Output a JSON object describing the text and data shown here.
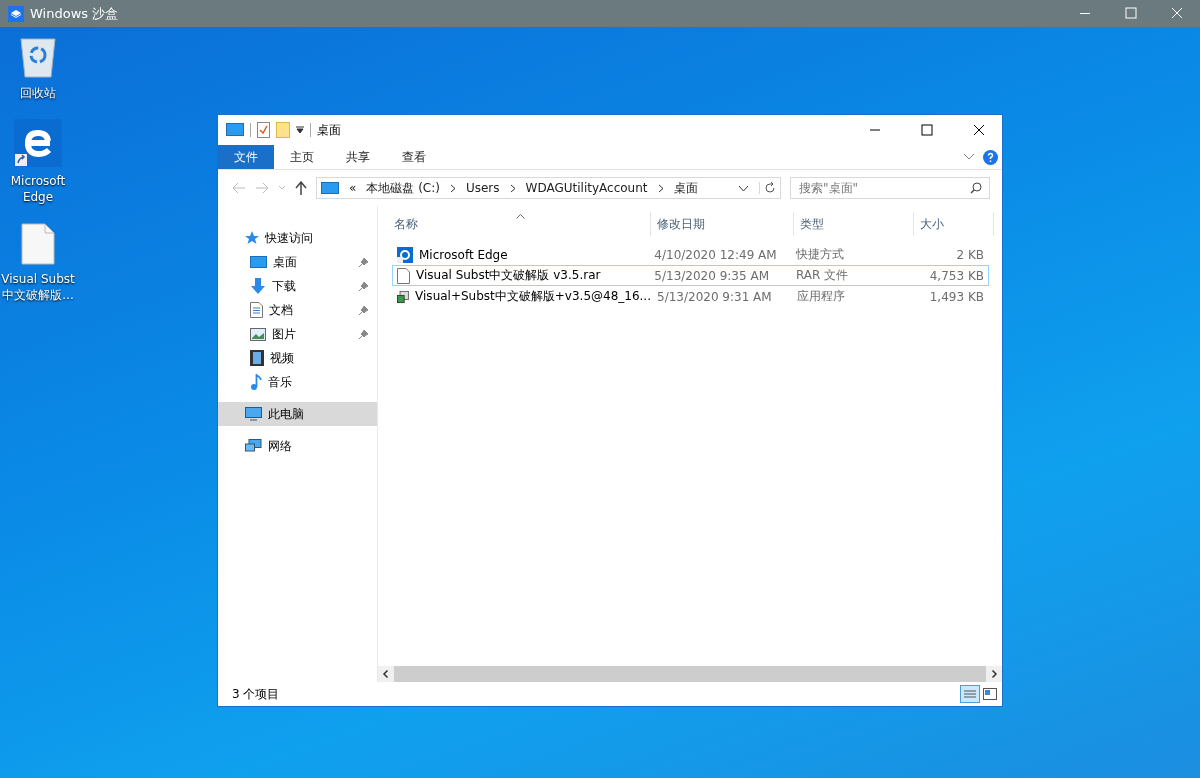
{
  "sandbox": {
    "title": "Windows 沙盒"
  },
  "desktop_icons": [
    {
      "label": "回收站",
      "kind": "recycle"
    },
    {
      "label": "Microsoft Edge",
      "kind": "edge"
    },
    {
      "label": "Visual Subst 中文破解版...",
      "kind": "file"
    }
  ],
  "explorer": {
    "title": "桌面",
    "ribbon_tabs": [
      {
        "label": "文件",
        "kind": "file"
      },
      {
        "label": "主页",
        "kind": "tab"
      },
      {
        "label": "共享",
        "kind": "tab"
      },
      {
        "label": "查看",
        "kind": "tab"
      }
    ],
    "address": {
      "prefix": "«",
      "segments": [
        "本地磁盘 (C:)",
        "Users",
        "WDAGUtilityAccount",
        "桌面"
      ]
    },
    "search": {
      "placeholder": "搜索\"桌面\""
    },
    "nav": [
      {
        "label": "快速访问",
        "kind": "star",
        "selected": false,
        "children": [
          {
            "label": "桌面",
            "kind": "desktop",
            "pinned": true,
            "selected": false
          },
          {
            "label": "下载",
            "kind": "download",
            "pinned": true,
            "selected": false
          },
          {
            "label": "文档",
            "kind": "document",
            "pinned": true,
            "selected": false
          },
          {
            "label": "图片",
            "kind": "picture",
            "pinned": true,
            "selected": false
          },
          {
            "label": "视频",
            "kind": "video",
            "pinned": false,
            "selected": false
          },
          {
            "label": "音乐",
            "kind": "music",
            "pinned": false,
            "selected": false
          }
        ]
      },
      {
        "label": "此电脑",
        "kind": "computer",
        "selected": true
      },
      {
        "label": "网络",
        "kind": "network",
        "selected": false
      }
    ],
    "columns": [
      "名称",
      "修改日期",
      "类型",
      "大小"
    ],
    "rows": [
      {
        "name": "Microsoft Edge",
        "date": "4/10/2020 12:49 AM",
        "type": "快捷方式",
        "size": "2 KB",
        "kind": "edge",
        "selected": false
      },
      {
        "name": "Visual Subst中文破解版 v3.5.rar",
        "date": "5/13/2020 9:35 AM",
        "type": "RAR 文件",
        "size": "4,753 KB",
        "kind": "file",
        "selected": true
      },
      {
        "name": "Visual+Subst中文破解版+v3.5@48_16...",
        "date": "5/13/2020 9:31 AM",
        "type": "应用程序",
        "size": "1,493 KB",
        "kind": "app",
        "selected": false
      }
    ],
    "status": "3 个项目"
  }
}
